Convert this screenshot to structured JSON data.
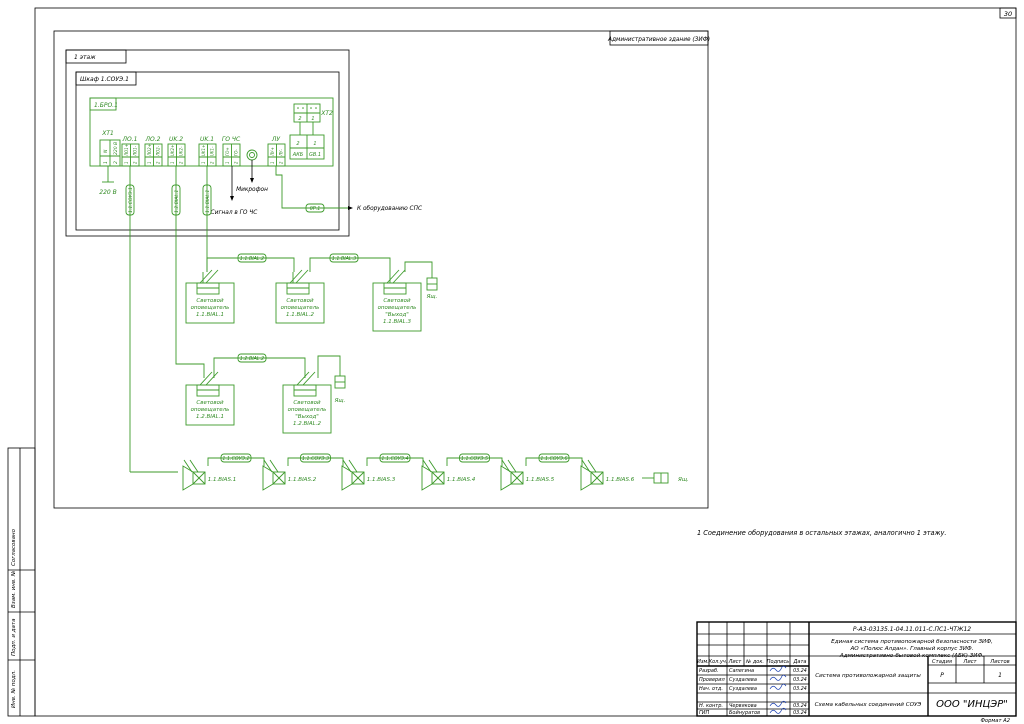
{
  "sheet": {
    "number": "30",
    "format": "Формат А2",
    "building_label": "Административное здание (ЗИФ)",
    "floor_label": "1 этаж",
    "cabinet_label": "Шкаф 1.СОУЭ.1",
    "bro_label": "1.БРО.1",
    "note": "1 Соединение оборудования в остальных этажах, аналогично 1 этажу."
  },
  "cabinet": {
    "xt1": "ХТ1",
    "xt2": "ХТ2",
    "groups": [
      {
        "name": "ХТ1",
        "pins": [
          "N",
          "220 В"
        ],
        "nums": [
          "1",
          "2"
        ]
      },
      {
        "name": "ЛО.1",
        "pins": [
          "ЛО1+",
          "ЛО1-"
        ],
        "nums": [
          "1",
          "2"
        ]
      },
      {
        "name": "ЛО.2",
        "pins": [
          "ЛО2+",
          "ЛО2-"
        ],
        "nums": [
          "1",
          "2"
        ]
      },
      {
        "name": "UK.2",
        "pins": [
          "UK2+",
          "UK2-"
        ],
        "nums": [
          "1",
          "2"
        ]
      },
      {
        "name": "UK.1",
        "pins": [
          "UK1+",
          "UK1-"
        ],
        "nums": [
          "1",
          "2"
        ]
      },
      {
        "name": "ГО ЧС",
        "pins": [
          "ГО+",
          "ГО-"
        ],
        "nums": [
          "1",
          "2"
        ]
      },
      {
        "name": "ЛУ",
        "pins": [
          "ЛУ+",
          "ЛУ-"
        ],
        "nums": [
          "1",
          "2"
        ]
      }
    ],
    "xt2_pins": [
      "АКБ",
      "GB.1"
    ],
    "xt2_nums": [
      "2",
      "1"
    ],
    "supply": "220 В",
    "microphone": "Микрофон",
    "signal_go": "Сигнал в ГО ЧС",
    "ops_cable": "0Р.1",
    "to_sps": "К оборудованию СПС"
  },
  "cables": {
    "c1": "1.1.СОУЭ.1",
    "c2": "1.2.BIAL.1",
    "c3": "1.1.BIAL.1",
    "c4": "1.1.BIAL.2",
    "c5": "1.1.BIAL.3",
    "c6": "1.2.BIAL.2",
    "s2": "1.1.СОУЭ.2",
    "s3": "1.1.СОУЭ.3",
    "s4": "1.1.СОУЭ.4",
    "s5": "1.1.СОУЭ.5",
    "s6": "1.1.СОУЭ.6"
  },
  "devices": {
    "light_word1": "Световой",
    "light_word2": "оповещатель",
    "exit_word": "\"Выход\"",
    "d1": "1.1.BIAL.1",
    "d2": "1.1.BIAL.2",
    "d3": "1.1.BIAL.3",
    "d4": "1.2.BIAL.1",
    "d5": "1.2.BIAL.2",
    "jb": "Ящ.",
    "sp": [
      "1.1.BIAS.1",
      "1.1.BIAS.2",
      "1.1.BIAS.3",
      "1.1.BIAS.4",
      "1.1.BIAS.5",
      "1.1.BIAS.6"
    ]
  },
  "side_stamp": [
    "Согласовано",
    "Взам. инв. №",
    "Подп. и дата",
    "Инв. № подл."
  ],
  "title_block": {
    "code": "Р-А3-03135.1-04.11.011-С.ПС1-ЧТЖ12",
    "project_lines": [
      "Единая система противопожарной безопасности ЗИФ,",
      "АО «Полюс Алдан». Главный корпус ЗИФ.",
      "Административно-бытовой комплекс (АБК) ЗИФ."
    ],
    "system_name": "Система противопожарной защиты",
    "doc_name": "Схема кабельных соединений СОУЭ",
    "company": "ООО \"ИНЦЭР\"",
    "head": [
      "Изм.",
      "Кол.уч.",
      "Лист",
      "№ док.",
      "Подпись",
      "Дата"
    ],
    "stage_head": [
      "Стадия",
      "Лист",
      "Листов"
    ],
    "stage": "Р",
    "sheets": "1",
    "rows": [
      {
        "role": "Разраб.",
        "name": "Сапегина",
        "date": "03.24"
      },
      {
        "role": "Проверил",
        "name": "Суздалева",
        "date": "03.24"
      },
      {
        "role": "Нач. отд.",
        "name": "Суздалева",
        "date": "03.24"
      },
      {
        "role": "",
        "name": "",
        "date": ""
      },
      {
        "role": "Н. контр.",
        "name": "Червякова",
        "date": "03.24"
      },
      {
        "role": "ГИП",
        "name": "Бойнуратов",
        "date": "03.24"
      }
    ]
  }
}
